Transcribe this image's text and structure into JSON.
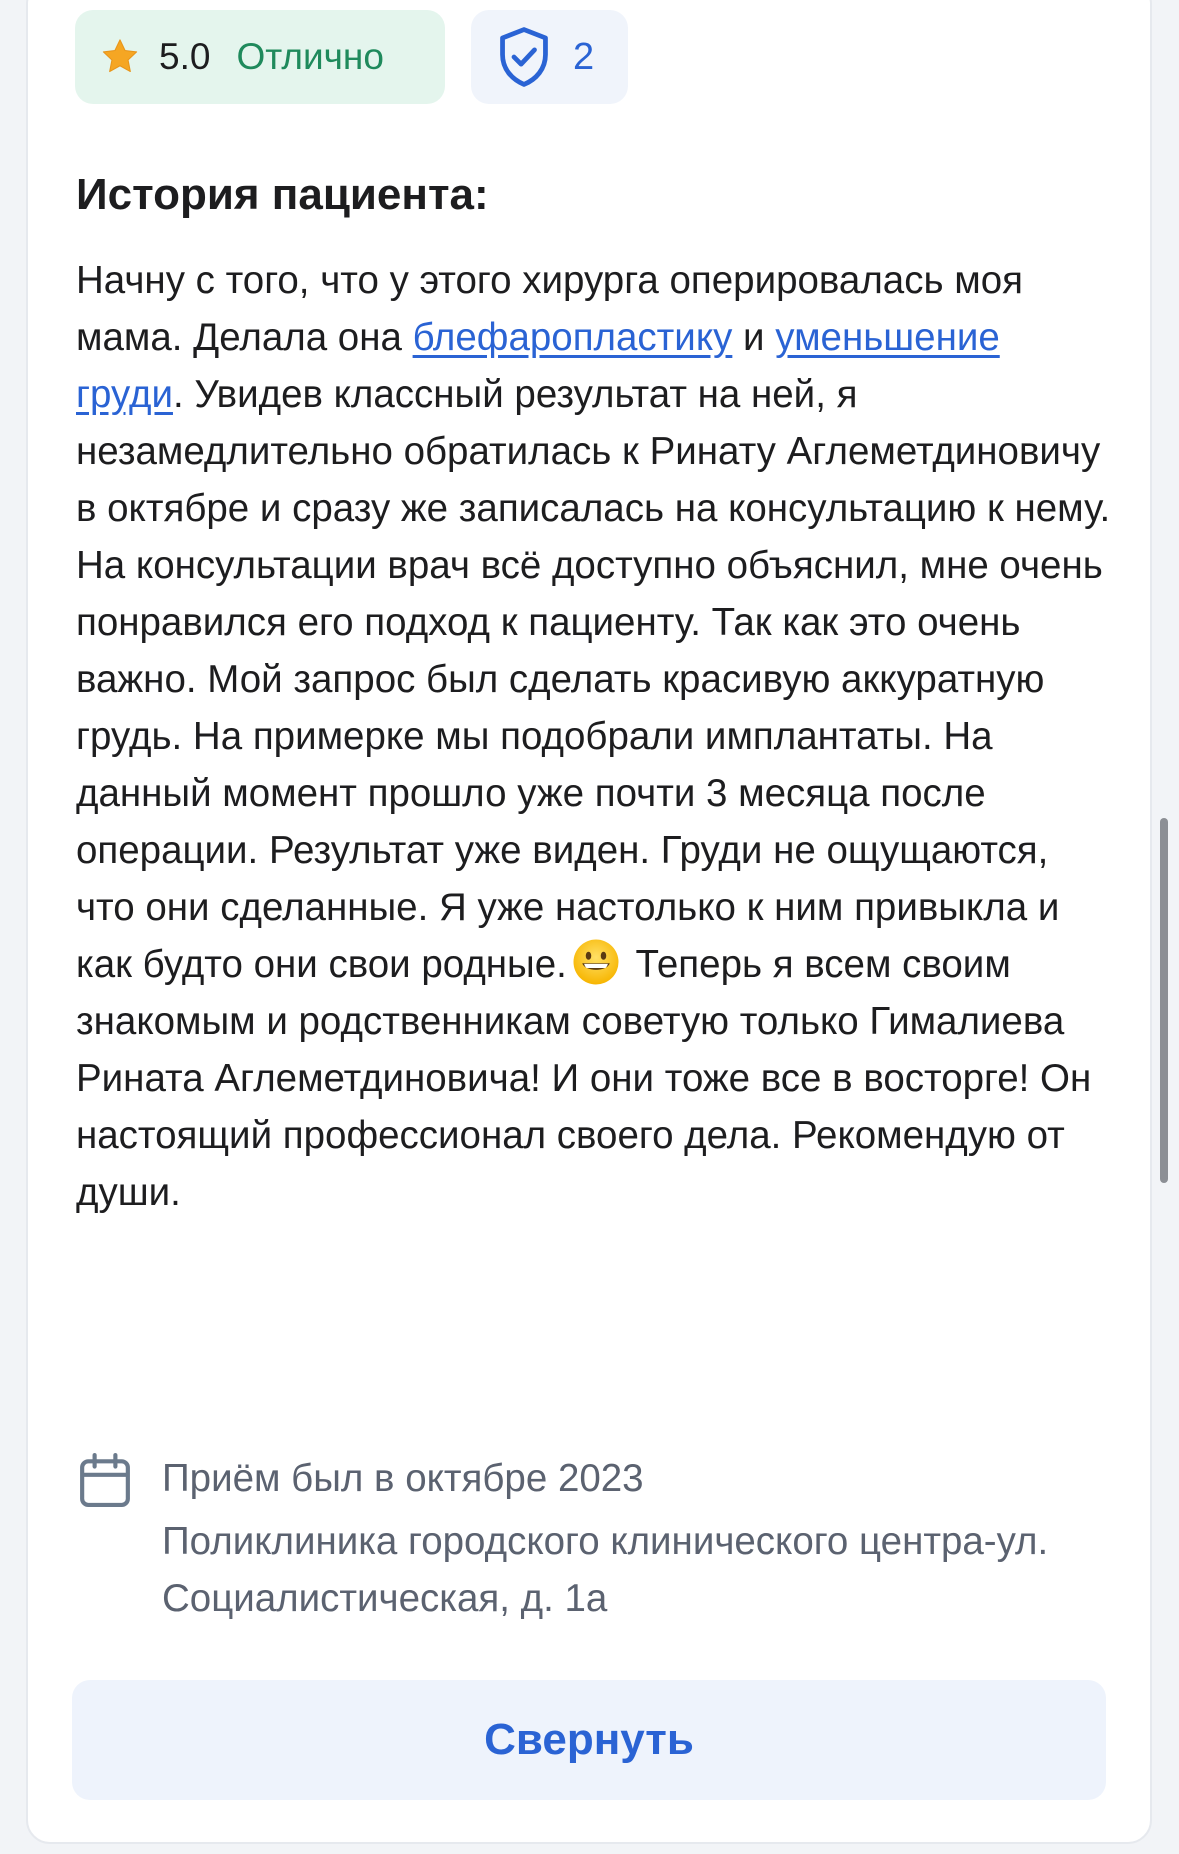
{
  "rating": {
    "score": "5.0",
    "label": "Отлично",
    "icon": "star-icon",
    "star_color": "#f5a623"
  },
  "verified": {
    "icon": "shield-check-icon",
    "count": "2"
  },
  "section_title": "История пациента:",
  "story": {
    "p1": "Начну с того, что у этого хирурга оперировалась моя мама. Делала она ",
    "link1": "блефаропластику",
    "p2": " и ",
    "link2": "уменьшение груди",
    "p3": ". Увидев классный результат на ней, я незамедлительно обратилась к Ринату Аглеметдиновичу в октябре и сразу же записалась на консультацию к нему. На консультации врач всё доступно объяснил, мне очень понравился его подход к пациенту. Так как это очень важно. Мой запрос был сделать красивую аккуратную грудь. На примерке мы подобрали имплантаты. На данный момент прошло уже почти 3 месяца после операции. Результат уже виден. Груди не ощущаются, что они сделанные. Я уже настолько к ним привыкла и как будто они свои родные.",
    "emoji": "grinning-face-emoji",
    "p4": " Теперь я всем своим знакомым и родственникам советую только Гималиева Рината Аглеметдиновича! И они тоже все в восторге! Он настоящий профессионал своего дела. Рекомендую от души."
  },
  "visit": {
    "icon": "calendar-icon",
    "date": "Приём был в октябре 2023",
    "clinic": "Поликлиника городского клинического центра-ул. Социалистическая, д. 1а"
  },
  "collapse_button": "Свернуть",
  "colors": {
    "accent": "#2a63d4",
    "rating_bg": "#e4f5ed",
    "rating_text": "#1f8a5c",
    "button_bg": "#eef3fc"
  }
}
